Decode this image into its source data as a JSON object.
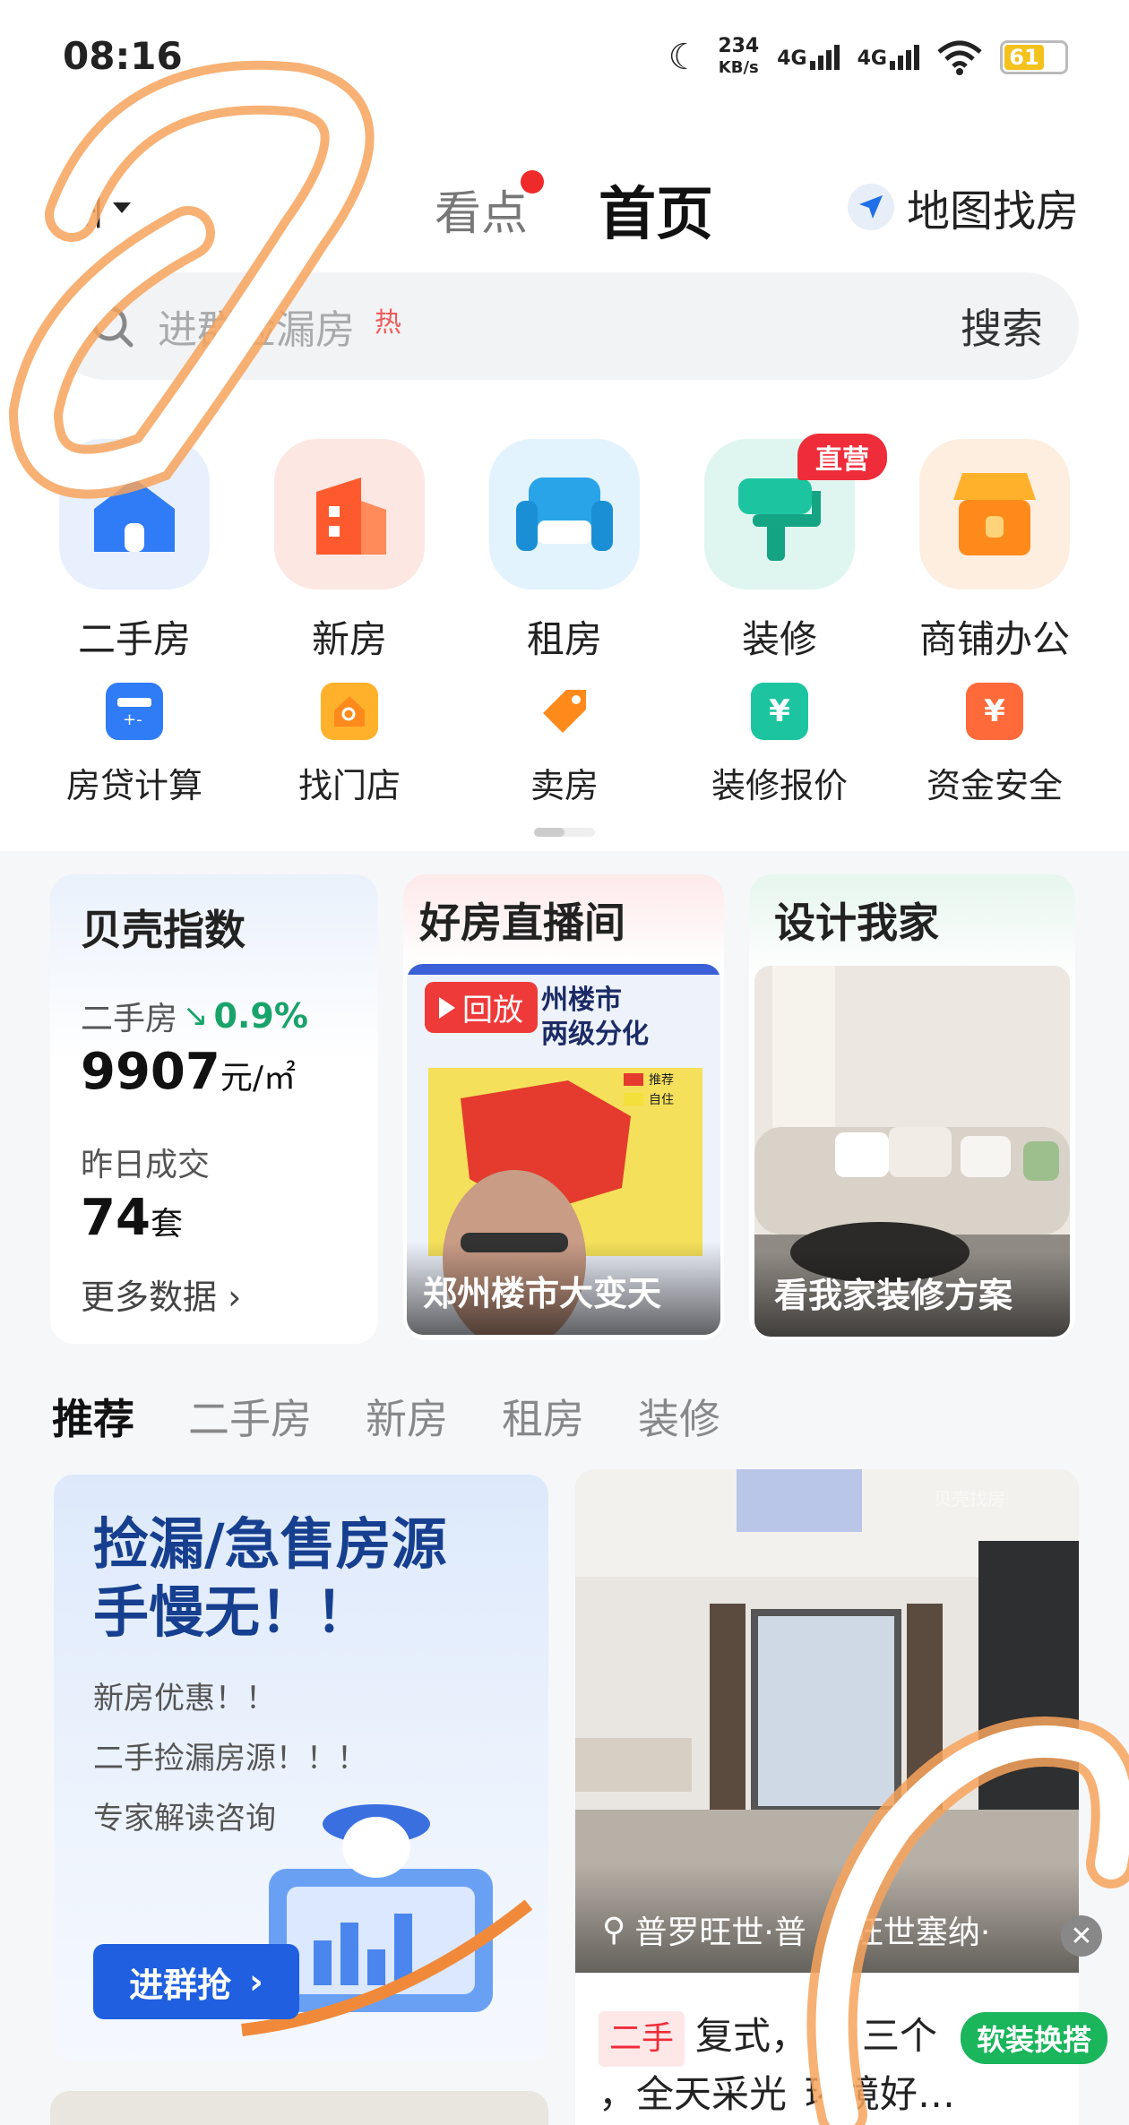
{
  "status_bar": {
    "time": "08:16",
    "net_speed_value": "234",
    "net_speed_unit": "KB/s",
    "signal_1": "4G",
    "signal_2": "4G",
    "battery": "61"
  },
  "header": {
    "city": "州",
    "tab_kandian": "看点",
    "tab_home": "首页",
    "map_find": "地图找房"
  },
  "search": {
    "placeholder": "进群捡漏房",
    "hot_label": "热",
    "button": "搜索"
  },
  "main_nav": [
    {
      "label": "二手房",
      "icon": "house-icon",
      "color": "#2f7cf6"
    },
    {
      "label": "新房",
      "icon": "building-icon",
      "color": "#ff6a3a"
    },
    {
      "label": "租房",
      "icon": "sofa-icon",
      "color": "#2aa4e8"
    },
    {
      "label": "装修",
      "icon": "paint-roller-icon",
      "color": "#1dc4a0",
      "badge": "直营"
    },
    {
      "label": "商铺办公",
      "icon": "shop-icon",
      "color": "#ff8a1c"
    }
  ],
  "tools_nav": [
    {
      "label": "房贷计算",
      "icon": "calculator-icon",
      "color": "#2f7cf6"
    },
    {
      "label": "找门店",
      "icon": "store-search-icon",
      "color": "#ff8a1c"
    },
    {
      "label": "卖房",
      "icon": "price-tag-icon",
      "color": "#ff8a1c"
    },
    {
      "label": "装修报价",
      "icon": "quote-yen-icon",
      "color": "#1dc4a0"
    },
    {
      "label": "资金安全",
      "icon": "money-safe-icon",
      "color": "#ff6a3a"
    }
  ],
  "index_card": {
    "title": "贝壳指数",
    "label_secondhand": "二手房",
    "change": "0.9%",
    "price": "9907",
    "price_unit": "元/㎡",
    "label_deals": "昨日成交",
    "deals": "74",
    "deals_unit": "套",
    "more": "更多数据"
  },
  "live_card": {
    "title": "好房直播间",
    "replay": "回放",
    "caption": "郑州楼市大变天",
    "poster_title_1": "州楼市",
    "poster_title_2": "两级分化",
    "legend_1": "推荐",
    "legend_2": "自住"
  },
  "design_card": {
    "title": "设计我家",
    "caption": "看我家装修方案"
  },
  "feed_tabs": [
    "推荐",
    "二手房",
    "新房",
    "租房",
    "装修"
  ],
  "feed_left": {
    "title_1": "捡漏/急售房源",
    "title_2": "手慢无！！",
    "line_1": "新房优惠！！",
    "line_2": "二手捡漏房源！！！",
    "line_3": "专家解读咨询",
    "button": "进群抢"
  },
  "feed_right": {
    "location": "普罗旺世·普",
    "location_2": "旺世塞纳·",
    "tag": "二手",
    "text_1": "复式，",
    "text_2": "三个",
    "text_3": "，全天采光",
    "text_4": "环境好…",
    "float_tag": "软装换搭",
    "watermark": "贝壳找房"
  },
  "colors": {
    "accent_blue": "#1f5fe0",
    "live_red": "#ef3a3a",
    "up_green": "#18a36a",
    "scribble_orange": "#f7a35c"
  }
}
